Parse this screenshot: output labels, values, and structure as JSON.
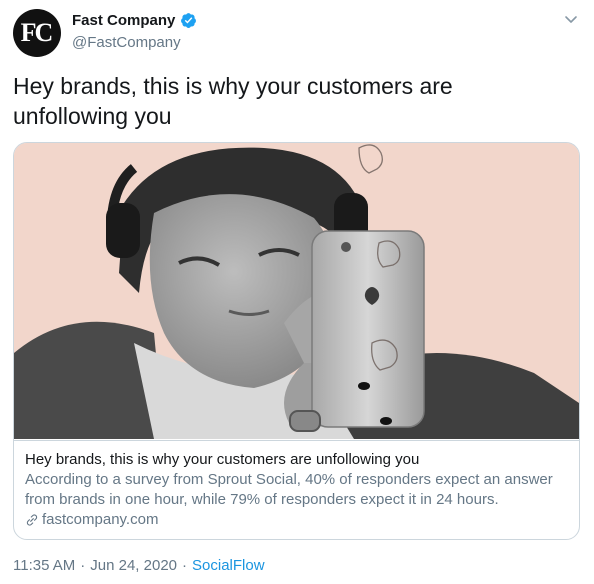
{
  "tweet": {
    "avatar_text": "FC",
    "display_name": "Fast Company",
    "handle": "@FastCompany",
    "text": "Hey brands, this is why your customers are unfollowing you",
    "time": "11:35 AM",
    "separator": "·",
    "date": "Jun 24, 2020",
    "source": "SocialFlow"
  },
  "card": {
    "title": "Hey brands, this is why your customers are unfollowing you",
    "description": "According to a survey from Sprout Social, 40% of responders expect an answer from brands in one hour, while 79% of responders expect it in 24 hours.",
    "domain": "fastcompany.com"
  },
  "icons": {
    "verified": "verified-badge-icon",
    "caret": "chevron-down-icon",
    "link": "link-icon"
  },
  "colors": {
    "verified_blue": "#1da1f2",
    "link_blue": "#1b95e0",
    "secondary_text": "#657786",
    "image_background": "#f2d6cb"
  }
}
